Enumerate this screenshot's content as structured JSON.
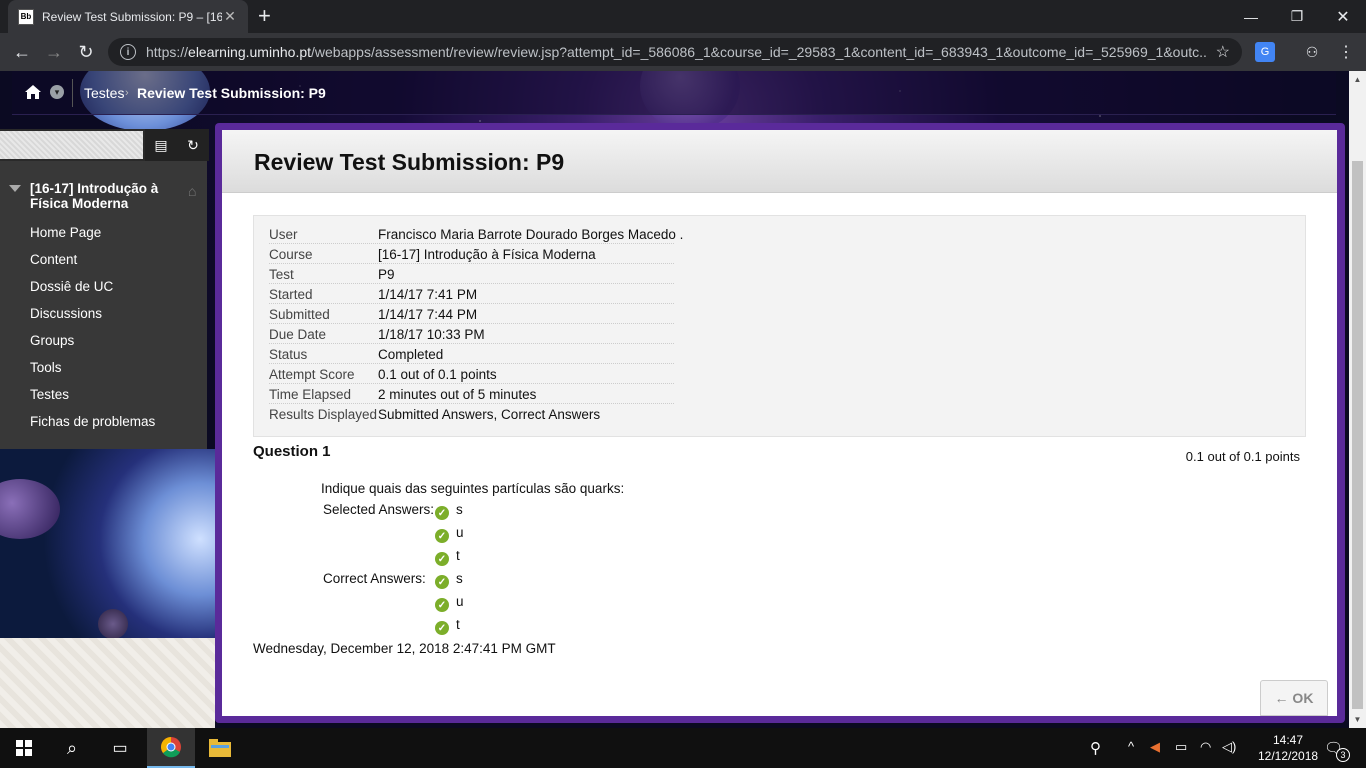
{
  "browser": {
    "tab_title": "Review Test Submission: P9 – [16",
    "favicon_text": "Bb",
    "url_domain": "elearning.uminho.pt",
    "url_prefix": "https://",
    "url_path": "/webapps/assessment/review/review.jsp?attempt_id=_586086_1&course_id=_29583_1&content_id=_683943_1&outcome_id=_525969_1&outc..."
  },
  "breadcrumb": {
    "items": [
      "Testes",
      "Review Test Submission: P9"
    ]
  },
  "sidebar": {
    "course_title": "[16-17] Introdução à Física Moderna",
    "items": [
      "Home Page",
      "Content",
      "Dossiê de UC",
      "Discussions",
      "Groups",
      "Tools",
      "Testes",
      "Fichas de problemas"
    ]
  },
  "main": {
    "title": "Review Test Submission: P9",
    "info": [
      {
        "key": "User",
        "value": "Francisco Maria Barrote Dourado Borges Macedo ."
      },
      {
        "key": "Course",
        "value": "[16-17] Introdução à Física Moderna"
      },
      {
        "key": "Test",
        "value": "P9"
      },
      {
        "key": "Started",
        "value": "1/14/17 7:41 PM"
      },
      {
        "key": "Submitted",
        "value": "1/14/17 7:44 PM"
      },
      {
        "key": "Due Date",
        "value": "1/18/17 10:33 PM"
      },
      {
        "key": "Status",
        "value": "Completed"
      },
      {
        "key": "Attempt Score",
        "value": "0.1 out of 0.1 points"
      },
      {
        "key": "Time Elapsed",
        "value": "2 minutes out of 5 minutes"
      },
      {
        "key": "Results Displayed",
        "value": "Submitted Answers, Correct Answers"
      }
    ],
    "question": {
      "title": "Question 1",
      "points": "0.1 out of 0.1 points",
      "text": "Indique quais das seguintes partículas são quarks:",
      "selected_label": "Selected Answers:",
      "selected": [
        "s",
        "u",
        "t"
      ],
      "correct_label": "Correct Answers:",
      "correct": [
        "s",
        "u",
        "t"
      ]
    },
    "timestamp": "Wednesday, December 12, 2018 2:47:41 PM GMT",
    "ok_label": "← OK"
  },
  "taskbar": {
    "time": "14:47",
    "date": "12/12/2018",
    "notification_count": "3"
  },
  "colors": {
    "check_green": "#7cae2a",
    "frame_purple": "#5a2a9a",
    "sidebar_bg": "#383838"
  }
}
